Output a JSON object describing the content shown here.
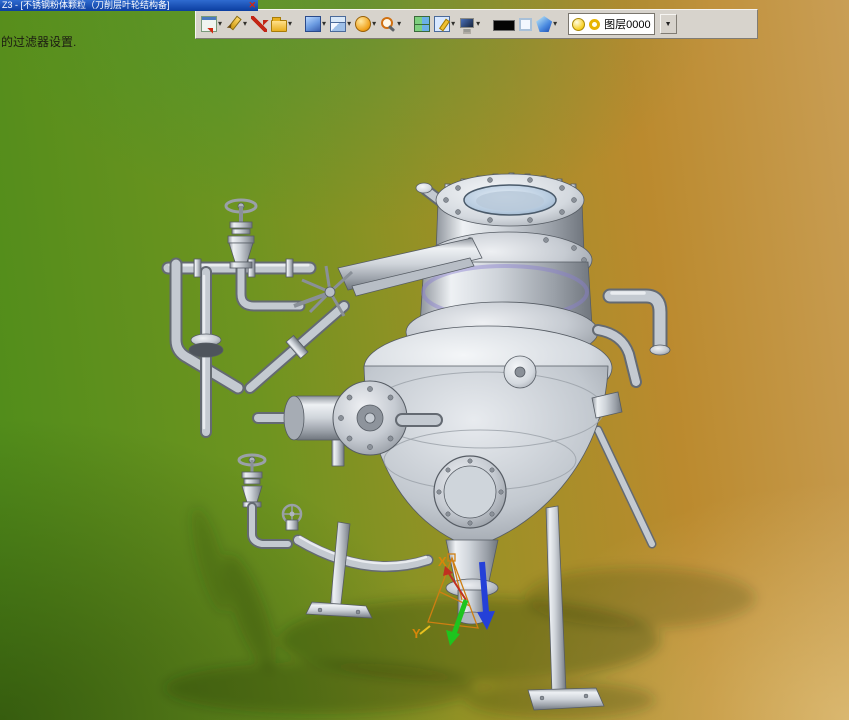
{
  "titlebar": {
    "title": "Z3 - [不锈钢粉体颗粒（刀削层叶轮结构备]",
    "close_glyph": "✕"
  },
  "tooltip": {
    "text": "的过滤器设置."
  },
  "toolbar": {
    "icons": [
      "export",
      "sketch",
      "datum",
      "open",
      "extrude",
      "cube",
      "revolve",
      "zoom",
      "viewport-split",
      "annotate",
      "display",
      "background-swatch-black",
      "highlight-swatch-light",
      "material"
    ],
    "layer": {
      "value": "图层0000"
    }
  },
  "glyphs": {
    "chevron_down": "▾",
    "combo_arrow": "▼"
  },
  "viewport": {
    "triad": {
      "x_label": "X",
      "y_label": "Y"
    },
    "colors": {
      "axis_x": "#d8860a",
      "axis_y": "#1ec41e",
      "axis_z": "#2440d8",
      "background_left": "#4e8c1a",
      "background_right": "#c99e55",
      "metal_light": "#eef1f4",
      "metal_dark": "#878d96"
    }
  }
}
